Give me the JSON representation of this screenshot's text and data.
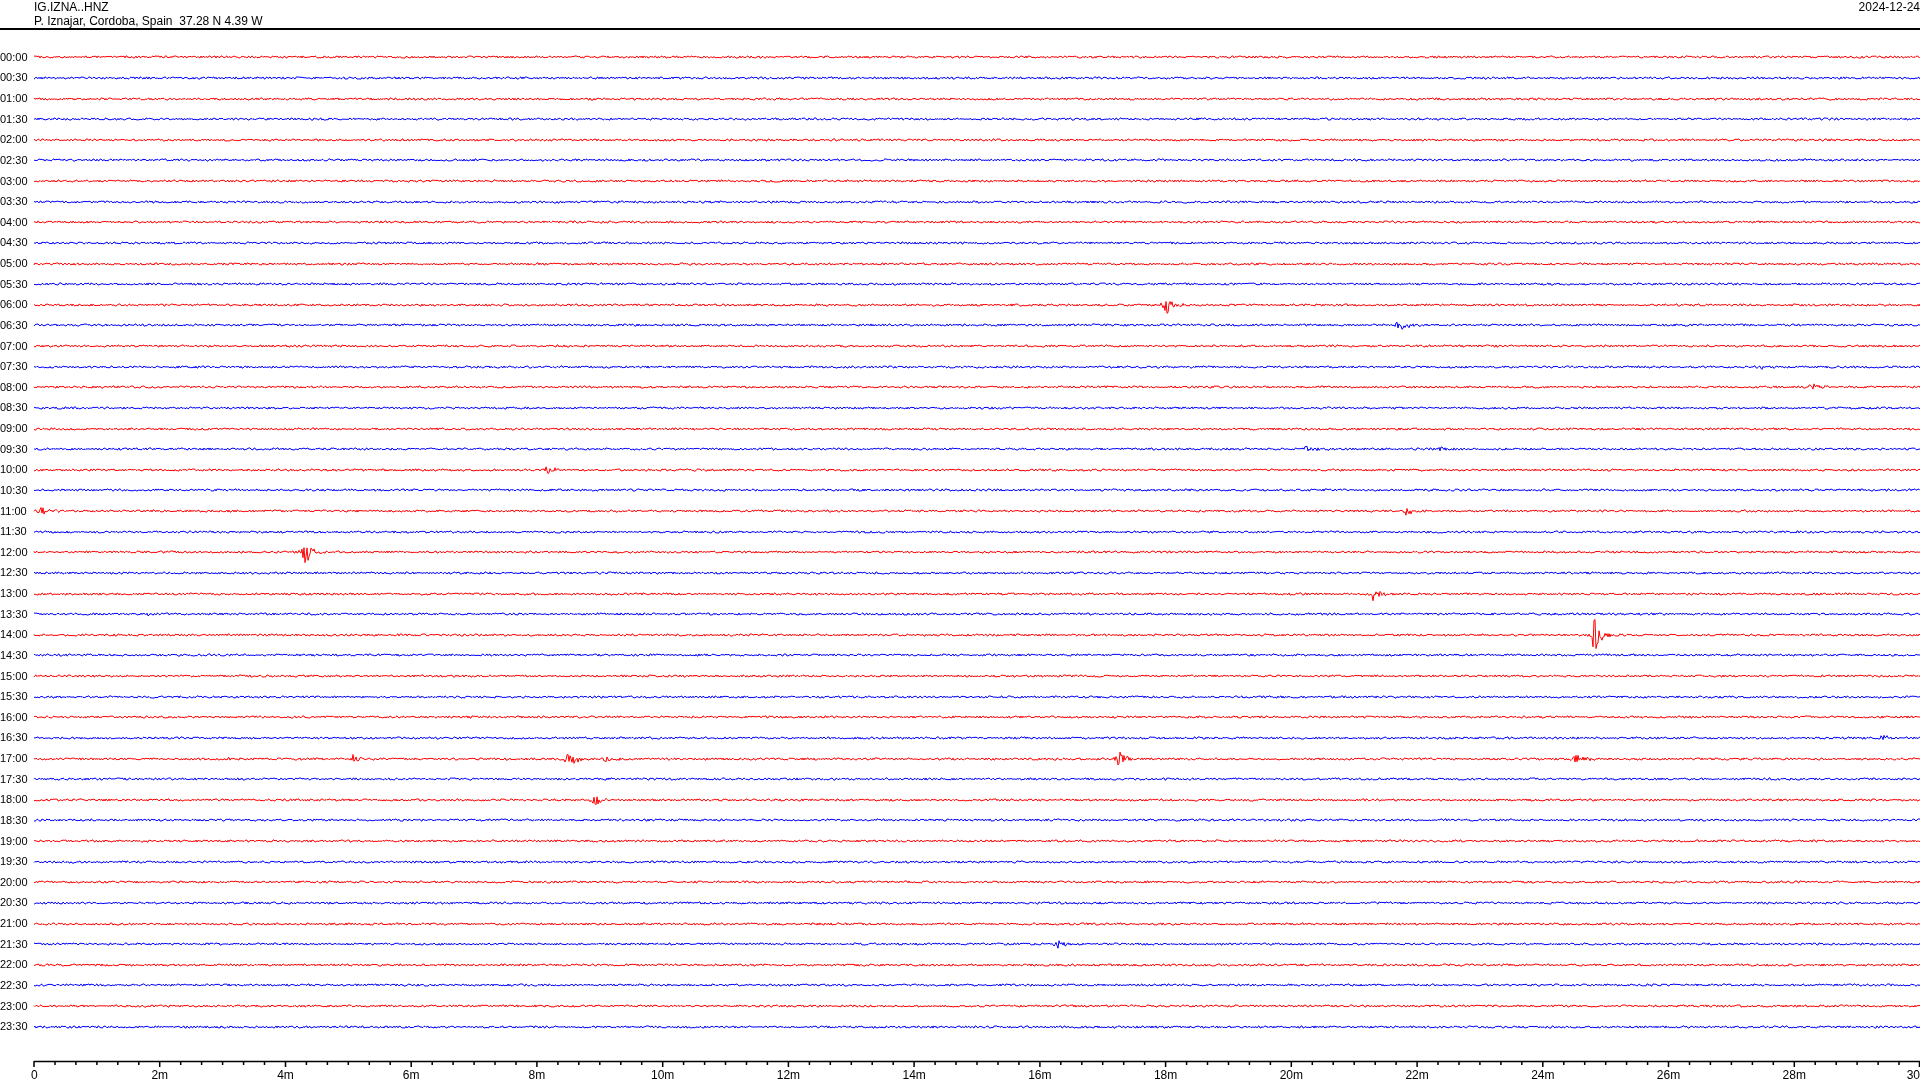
{
  "header": {
    "station": "IG.IZNA..HNZ",
    "location": "P. Iznajar, Cordoba, Spain  37.28 N 4.39 W",
    "date": "2024-12-24"
  },
  "rows": [
    {
      "label": "00:00",
      "color": "#ff0000"
    },
    {
      "label": "00:30",
      "color": "#0000ff"
    },
    {
      "label": "01:00",
      "color": "#ff0000"
    },
    {
      "label": "01:30",
      "color": "#0000ff"
    },
    {
      "label": "02:00",
      "color": "#ff0000"
    },
    {
      "label": "02:30",
      "color": "#0000ff"
    },
    {
      "label": "03:00",
      "color": "#ff0000"
    },
    {
      "label": "03:30",
      "color": "#0000ff"
    },
    {
      "label": "04:00",
      "color": "#ff0000"
    },
    {
      "label": "04:30",
      "color": "#0000ff"
    },
    {
      "label": "05:00",
      "color": "#ff0000"
    },
    {
      "label": "05:30",
      "color": "#0000ff"
    },
    {
      "label": "06:00",
      "color": "#ff0000"
    },
    {
      "label": "06:30",
      "color": "#0000ff"
    },
    {
      "label": "07:00",
      "color": "#ff0000"
    },
    {
      "label": "07:30",
      "color": "#0000ff"
    },
    {
      "label": "08:00",
      "color": "#ff0000"
    },
    {
      "label": "08:30",
      "color": "#0000ff"
    },
    {
      "label": "09:00",
      "color": "#ff0000"
    },
    {
      "label": "09:30",
      "color": "#0000ff"
    },
    {
      "label": "10:00",
      "color": "#ff0000"
    },
    {
      "label": "10:30",
      "color": "#0000ff"
    },
    {
      "label": "11:00",
      "color": "#ff0000"
    },
    {
      "label": "11:30",
      "color": "#0000ff"
    },
    {
      "label": "12:00",
      "color": "#ff0000"
    },
    {
      "label": "12:30",
      "color": "#0000ff"
    },
    {
      "label": "13:00",
      "color": "#ff0000"
    },
    {
      "label": "13:30",
      "color": "#0000ff"
    },
    {
      "label": "14:00",
      "color": "#ff0000"
    },
    {
      "label": "14:30",
      "color": "#0000ff"
    },
    {
      "label": "15:00",
      "color": "#ff0000"
    },
    {
      "label": "15:30",
      "color": "#0000ff"
    },
    {
      "label": "16:00",
      "color": "#ff0000"
    },
    {
      "label": "16:30",
      "color": "#0000ff"
    },
    {
      "label": "17:00",
      "color": "#ff0000"
    },
    {
      "label": "17:30",
      "color": "#0000ff"
    },
    {
      "label": "18:00",
      "color": "#ff0000"
    },
    {
      "label": "18:30",
      "color": "#0000ff"
    },
    {
      "label": "19:00",
      "color": "#ff0000"
    },
    {
      "label": "19:30",
      "color": "#0000ff"
    },
    {
      "label": "20:00",
      "color": "#ff0000"
    },
    {
      "label": "20:30",
      "color": "#0000ff"
    },
    {
      "label": "21:00",
      "color": "#ff0000"
    },
    {
      "label": "21:30",
      "color": "#0000ff"
    },
    {
      "label": "22:00",
      "color": "#ff0000"
    },
    {
      "label": "22:30",
      "color": "#0000ff"
    },
    {
      "label": "23:00",
      "color": "#ff0000"
    },
    {
      "label": "23:30",
      "color": "#0000ff"
    }
  ],
  "x_axis": {
    "ticks": [
      "0",
      "2m",
      "4m",
      "6m",
      "8m",
      "10m",
      "12m",
      "14m",
      "16m",
      "18m",
      "20m",
      "22m",
      "24m",
      "26m",
      "28m",
      "30"
    ]
  }
}
